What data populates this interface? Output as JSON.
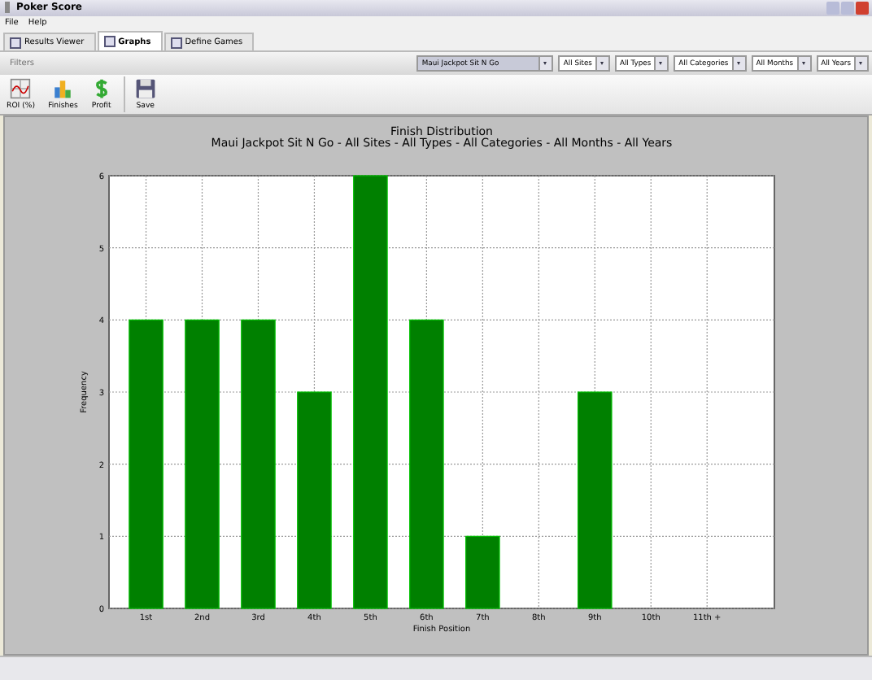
{
  "window": {
    "title": "Poker Score"
  },
  "menu": [
    "File",
    "Help"
  ],
  "tabs": [
    {
      "label": "Results Viewer",
      "selected": false
    },
    {
      "label": "Graphs",
      "selected": true
    },
    {
      "label": "Define Games",
      "selected": false
    }
  ],
  "filters": {
    "label": "Filters",
    "dropdowns": [
      "Maui Jackpot Sit N Go",
      "All Sites",
      "All Types",
      "All Categories",
      "All Months",
      "All Years"
    ]
  },
  "toolbar": [
    {
      "label": "ROI (%)",
      "kind": "roi"
    },
    {
      "label": "Finishes",
      "kind": "finishes"
    },
    {
      "label": "Profit",
      "kind": "profit"
    },
    {
      "label": "Save",
      "kind": "save"
    }
  ],
  "chart": {
    "chart_data": {
      "type": "bar",
      "title": "Finish Distribution\nMaui Jackpot Sit N Go - All Sites - All Types - All Categories - All Months - All Years",
      "xlabel": "Finish Position",
      "ylabel": "Frequency",
      "categories": [
        "1st",
        "2nd",
        "3rd",
        "4th",
        "5th",
        "6th",
        "7th",
        "8th",
        "9th",
        "10th",
        "11th +"
      ],
      "grid": true,
      "series": [
        {
          "color": "#008000",
          "values": [
            4,
            4,
            4,
            3,
            6,
            4,
            1,
            0,
            3,
            0,
            0
          ]
        }
      ],
      "ylim": [
        0,
        6
      ],
      "yticks": [
        0,
        1,
        2,
        3,
        4,
        5,
        6
      ]
    }
  }
}
